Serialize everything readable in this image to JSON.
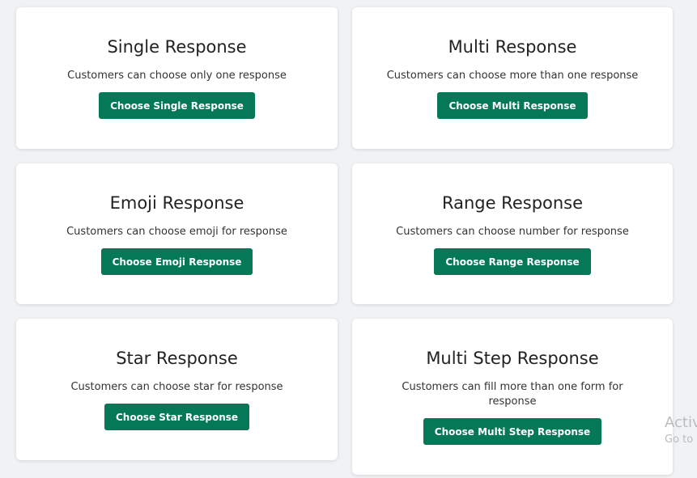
{
  "cards": [
    {
      "title": "Single Response",
      "description": "Customers can choose only one response",
      "button_label": "Choose Single Response"
    },
    {
      "title": "Multi Response",
      "description": "Customers can choose more than one response",
      "button_label": "Choose Multi Response"
    },
    {
      "title": "Emoji Response",
      "description": "Customers can choose emoji for response",
      "button_label": "Choose Emoji Response"
    },
    {
      "title": "Range Response",
      "description": "Customers can choose number for response",
      "button_label": "Choose Range Response"
    },
    {
      "title": "Star Response",
      "description": "Customers can choose star for response",
      "button_label": "Choose Star Response"
    },
    {
      "title": "Multi Step Response",
      "description": "Customers can fill more than one form for response",
      "button_label": "Choose Multi Step Response"
    }
  ],
  "watermark": {
    "line1": "Activ",
    "line2": "Go to"
  },
  "colors": {
    "accent": "#047857",
    "background": "#f1f2f4",
    "card": "#ffffff"
  }
}
